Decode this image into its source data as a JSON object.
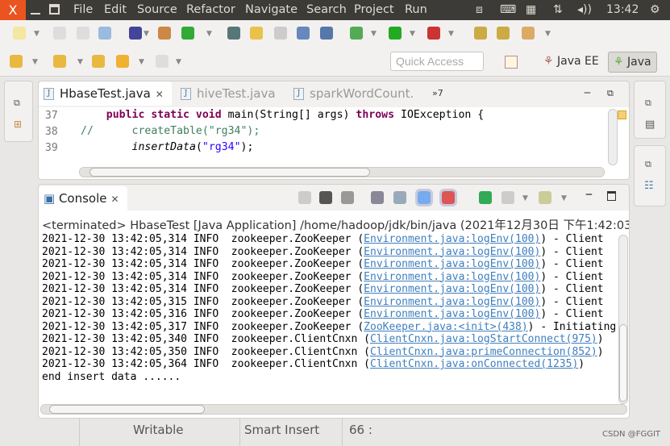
{
  "window": {
    "close_label": "X"
  },
  "menu": [
    "File",
    "Edit",
    "Source",
    "Refactor",
    "Navigate",
    "Search",
    "Project",
    "Run"
  ],
  "tray": {
    "time": "13:42"
  },
  "toolbar": {
    "quick_access_placeholder": "Quick Access",
    "perspectives": [
      "Java EE",
      "Java"
    ],
    "active_perspective": "Java"
  },
  "editor": {
    "tabs": [
      {
        "label": "HbaseTest.java",
        "active": true
      },
      {
        "label": "hiveTest.java"
      },
      {
        "label": "sparkWordCount."
      }
    ],
    "overflow_label": "»7",
    "lines": [
      {
        "num": "37",
        "parts": [
          [
            "",
            "    "
          ],
          [
            "kw",
            "public static void"
          ],
          [
            "",
            " main(String[] args) "
          ],
          [
            "kw",
            "throws"
          ],
          [
            "",
            " IOException {"
          ]
        ]
      },
      {
        "num": "38",
        "parts": [
          [
            "cm",
            "//      createTable(\"rg34\");"
          ]
        ]
      },
      {
        "num": "39",
        "parts": [
          [
            "",
            "        "
          ],
          [
            "it",
            "insertData"
          ],
          [
            "",
            "("
          ],
          [
            "str",
            "\"rg34\""
          ],
          [
            "",
            ");"
          ]
        ]
      }
    ]
  },
  "console": {
    "title": "Console",
    "status": "<terminated> HbaseTest [Java Application] /home/hadoop/jdk/bin/java (2021年12月30日 下午1:42:03)",
    "lines": [
      {
        "pre": "2021-12-30 13:42:05,314 INFO  zookeeper.ZooKeeper (",
        "link": "Environment.java:logEnv(100)",
        "post": ") - Client"
      },
      {
        "pre": "2021-12-30 13:42:05,314 INFO  zookeeper.ZooKeeper (",
        "link": "Environment.java:logEnv(100)",
        "post": ") - Client"
      },
      {
        "pre": "2021-12-30 13:42:05,314 INFO  zookeeper.ZooKeeper (",
        "link": "Environment.java:logEnv(100)",
        "post": ") - Client"
      },
      {
        "pre": "2021-12-30 13:42:05,314 INFO  zookeeper.ZooKeeper (",
        "link": "Environment.java:logEnv(100)",
        "post": ") - Client"
      },
      {
        "pre": "2021-12-30 13:42:05,314 INFO  zookeeper.ZooKeeper (",
        "link": "Environment.java:logEnv(100)",
        "post": ") - Client"
      },
      {
        "pre": "2021-12-30 13:42:05,315 INFO  zookeeper.ZooKeeper (",
        "link": "Environment.java:logEnv(100)",
        "post": ") - Client"
      },
      {
        "pre": "2021-12-30 13:42:05,316 INFO  zookeeper.ZooKeeper (",
        "link": "Environment.java:logEnv(100)",
        "post": ") - Client"
      },
      {
        "pre": "2021-12-30 13:42:05,317 INFO  zookeeper.ZooKeeper (",
        "link": "ZooKeeper.java:<init>(438)",
        "post": ") - Initiating"
      },
      {
        "pre": "2021-12-30 13:42:05,340 INFO  zookeeper.ClientCnxn (",
        "link": "ClientCnxn.java:logStartConnect(975)",
        "post": ")"
      },
      {
        "pre": "2021-12-30 13:42:05,350 INFO  zookeeper.ClientCnxn (",
        "link": "ClientCnxn.java:primeConnection(852)",
        "post": ")"
      },
      {
        "pre": "2021-12-30 13:42:05,364 INFO  zookeeper.ClientCnxn (",
        "link": "ClientCnxn.java:onConnected(1235)",
        "post": ")"
      },
      {
        "pre": "end insert data ......",
        "link": "",
        "post": ""
      }
    ]
  },
  "statusbar": {
    "writable": "Writable",
    "insert_mode": "Smart Insert",
    "position": "66 :"
  },
  "watermark": "CSDN @FGGIT"
}
